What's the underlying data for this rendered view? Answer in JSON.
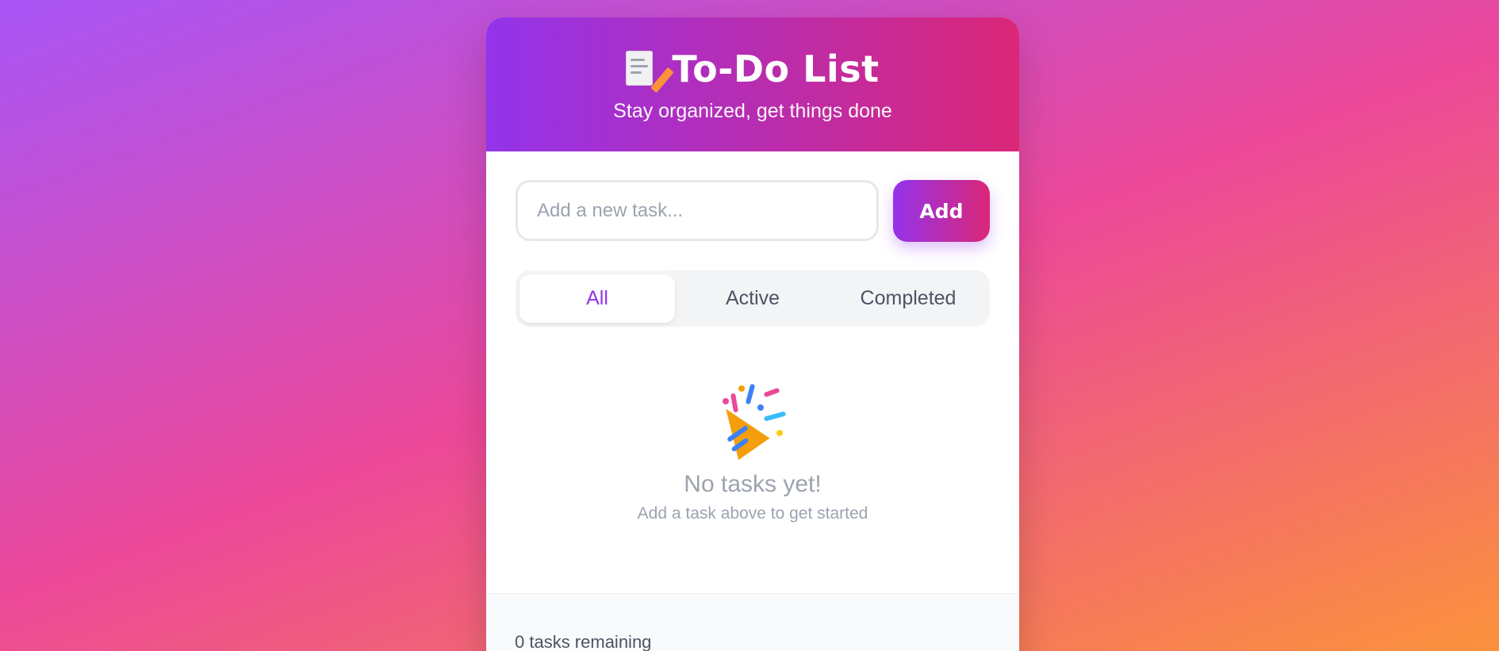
{
  "header": {
    "icon": "memo-icon",
    "title": "To-Do List",
    "subtitle": "Stay organized, get things done"
  },
  "add_form": {
    "placeholder": "Add a new task...",
    "value": "",
    "button_label": "Add"
  },
  "filters": [
    {
      "label": "All",
      "active": true
    },
    {
      "label": "Active",
      "active": false
    },
    {
      "label": "Completed",
      "active": false
    }
  ],
  "empty_state": {
    "icon": "party-popper-icon",
    "title": "No tasks yet!",
    "subtitle": "Add a task above to get started"
  },
  "footer": {
    "remaining_text": "0 tasks remaining"
  },
  "colors": {
    "accent_start": "#9333ea",
    "accent_end": "#db2777"
  }
}
